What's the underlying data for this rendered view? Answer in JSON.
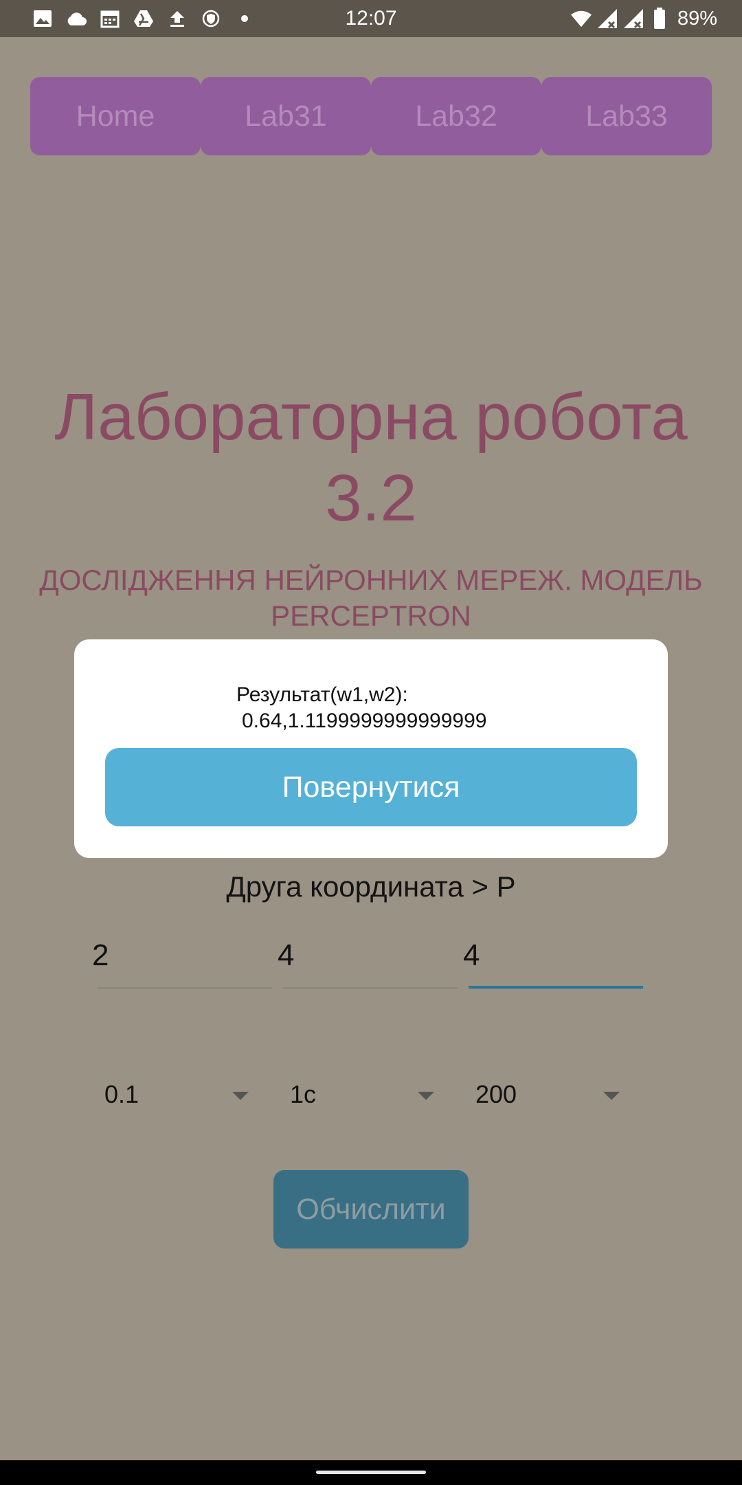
{
  "status_bar": {
    "time": "12:07",
    "battery_percent": "89%",
    "left_icons": [
      "image-icon",
      "cloud-icon",
      "calendar-icon",
      "drive-icon",
      "upload-icon",
      "shield-icon",
      "dot-icon"
    ],
    "right_icons": [
      "wifi-icon",
      "signal-icon",
      "signal-icon",
      "battery-icon"
    ]
  },
  "nav": {
    "tabs": [
      {
        "label": "Home"
      },
      {
        "label": "Lab31"
      },
      {
        "label": "Lab32"
      },
      {
        "label": "Lab33"
      }
    ]
  },
  "page": {
    "title_line1": "Лабораторна робота",
    "title_line2": "3.2",
    "subtitle_line1": "ДОСЛІДЖЕННЯ НЕЙРОННИХ МЕРЕЖ. МОДЕЛЬ",
    "subtitle_line2": "PERCEPTRON"
  },
  "form": {
    "coord_label": "Друга координата > P",
    "inputs": [
      {
        "value": "2"
      },
      {
        "value": "4"
      },
      {
        "value": "4"
      }
    ],
    "selects": [
      {
        "value": "0.1"
      },
      {
        "value": "1с"
      },
      {
        "value": "200"
      }
    ],
    "compute_label": "Обчислити"
  },
  "modal": {
    "result_label": "Результат(w1,w2):",
    "result_value": "0.64,1.1199999999999999",
    "back_label": "Повернутися"
  },
  "colors": {
    "background": "#9a9284",
    "nav_button": "#925d9c",
    "title": "#8a4a63",
    "compute_button": "#396f84",
    "modal_button": "#55b2d6"
  }
}
